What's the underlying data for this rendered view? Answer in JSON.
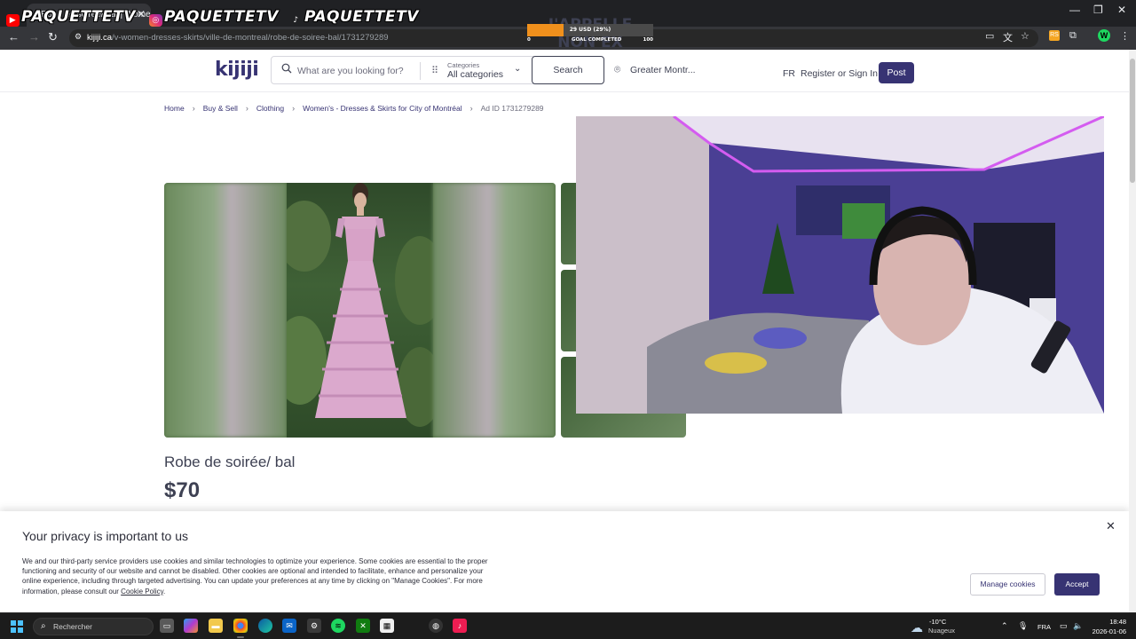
{
  "browser": {
    "tab_title": "Robe de soirée/ bal | Women's",
    "url_domain": "kijiji.ca",
    "url_path": "/v-women-dresses-skirts/ville-de-montreal/robe-de-soiree-bal/1731279289",
    "profile_initial": "W"
  },
  "stream": {
    "youtube": "PAQUETTETV",
    "instagram": "PAQUETTETV",
    "tiktok": "PAQUETTETV",
    "goal_title": "J'APPELLE NON EX",
    "goal_amount": "29 USD (29%)",
    "goal_progress": 0.29,
    "goal_min": "0",
    "goal_caption": "GOAL COMPLETED",
    "goal_max": "100"
  },
  "header": {
    "logo": "kijiji",
    "search_placeholder": "What are you looking for?",
    "categories_label": "Categories",
    "categories_value": "All categories",
    "search_button": "Search",
    "location": "Greater Montr...",
    "lang": "FR",
    "register": "Register or Sign In",
    "post": "Post"
  },
  "breadcrumb": [
    "Home",
    "Buy & Sell",
    "Clothing",
    "Women's - Dresses & Skirts for City of Montréal",
    "Ad ID 1731279289"
  ],
  "listing": {
    "title": "Robe de soirée/ bal",
    "price": "$70"
  },
  "privacy": {
    "heading": "Your privacy is important to us",
    "body": "We and our third-party service providers use cookies and similar technologies to optimize your experience. Some cookies are essential to the proper functioning and security of our website and cannot be disabled. Other cookies are optional and intended to facilitate, enhance and personalize your online experience, including through targeted advertising. You can update your preferences at any time by clicking on \"Manage Cookies\". For more information, please consult our ",
    "link": "Cookie Policy",
    "end": ".",
    "manage": "Manage cookies",
    "accept": "Accept"
  },
  "taskbar": {
    "search": "Rechercher",
    "temp": "-10°C",
    "condition": "Nuageux",
    "lang": "FRA",
    "time": "18:48",
    "date": "2026-01-06"
  },
  "colors": {
    "kijiji_purple": "#373373",
    "text": "#3e4153",
    "goal_fill": "#f0901c"
  }
}
